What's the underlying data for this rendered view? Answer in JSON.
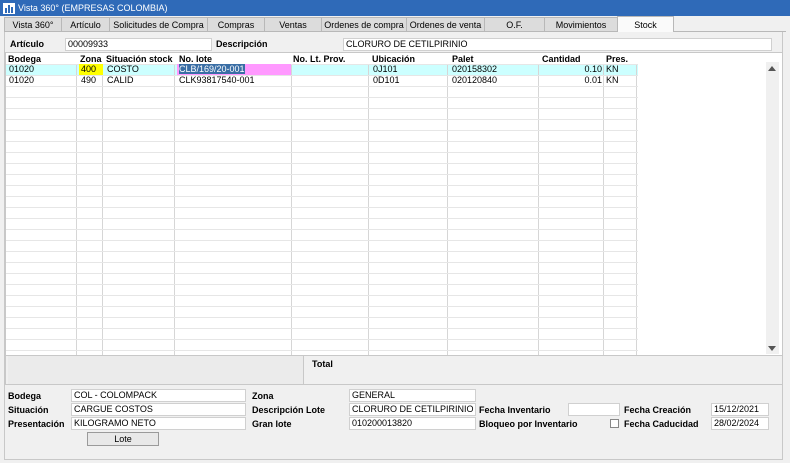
{
  "window": {
    "title": "Vista 360° (EMPRESAS COLOMBIA)"
  },
  "tabs": [
    "Vista 360°",
    "Artículo",
    "Solicitudes de Compra",
    "Compras",
    "Ventas",
    "Ordenes de compra",
    "Ordenes de venta",
    "O.F.",
    "Movimientos",
    "Stock"
  ],
  "header": {
    "articulo_label": "Artículo",
    "articulo_value": "00009933",
    "descripcion_label": "Descripción",
    "descripcion_value": "CLORURO DE CETILPIRINIO"
  },
  "grid": {
    "columns": [
      "Bodega",
      "Zona",
      "Situación stock",
      "No. lote",
      "No. Lt. Prov.",
      "Ubicación",
      "Palet",
      "Cantidad",
      "Pres."
    ],
    "rows": [
      [
        "01020",
        "400",
        "COSTO",
        "CLB/169/20-001",
        "",
        "0J101",
        "020158302",
        "0.10",
        "KN"
      ],
      [
        "01020",
        "490",
        "CALID",
        "CLK93817540-001",
        "",
        "0D101",
        "020120840",
        "0.01",
        "KN"
      ]
    ],
    "total_label": "Total"
  },
  "details": {
    "bodega_label": "Bodega",
    "bodega_value": "COL - COLOMPACK",
    "situacion_label": "Situación",
    "situacion_value": "CARGUE COSTOS",
    "presentacion_label": "Presentación",
    "presentacion_value": "KILOGRAMO NETO",
    "zona_label": "Zona",
    "zona_value": "GENERAL",
    "desc_lote_label": "Descripción Lote",
    "desc_lote_value": "CLORURO DE CETILPIRINIO",
    "gran_lote_label": "Gran lote",
    "gran_lote_value": "010200013820",
    "fecha_inv_label": "Fecha Inventario",
    "fecha_inv_value": "",
    "bloqueo_label": "Bloqueo por Inventario",
    "fecha_creacion_label": "Fecha Creación",
    "fecha_creacion_value": "15/12/2021",
    "fecha_caducidad_label": "Fecha Caducidad",
    "fecha_caducidad_value": "28/02/2024",
    "lote_button": "Lote"
  },
  "colors": {
    "titlebar": "#2f6ab8",
    "selected_row": "#ccffff",
    "zona_highlight": "#ffff00",
    "lote_highlight": "#ff99ff"
  }
}
